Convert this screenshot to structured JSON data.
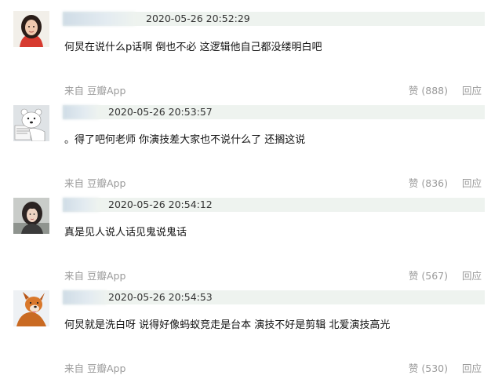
{
  "comments": [
    {
      "time": "2020-05-26 20:52:29",
      "text": "何炅在说什么p话啊 倒也不必 这逻辑他自己都没缕明白吧",
      "source": "来自 豆瓣App",
      "like_label": "赞 (888)",
      "reply_label": "回应",
      "avatar_icon": "woman-portrait-icon"
    },
    {
      "time": "2020-05-26 20:53:57",
      "text": "。得了吧何老师 你演技差大家也不说什么了 还搁这说",
      "source": "来自 豆瓣App",
      "like_label": "赞 (836)",
      "reply_label": "回应",
      "avatar_icon": "bear-icon"
    },
    {
      "time": "2020-05-26 20:54:12",
      "text": "真是见人说人话见鬼说鬼话",
      "source": "来自 豆瓣App",
      "like_label": "赞 (567)",
      "reply_label": "回应",
      "avatar_icon": "girl-portrait-icon"
    },
    {
      "time": "2020-05-26 20:54:53",
      "text": "何炅就是洗白呀 说得好像蚂蚁竞走是台本 演技不好是剪辑 北爱演技高光",
      "source": "来自 豆瓣App",
      "like_label": "赞 (530)",
      "reply_label": "回应",
      "avatar_icon": "dog-icon"
    }
  ],
  "colors": {
    "meta_bar": "#eef3ef",
    "muted_text": "#9a9a9a",
    "body_text": "#111111"
  }
}
